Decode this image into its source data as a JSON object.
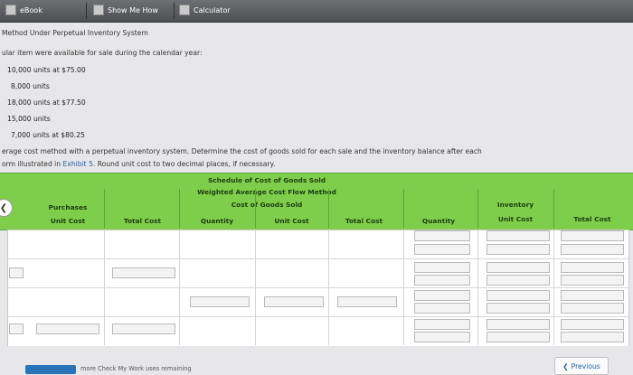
{
  "toolbar": {
    "ebook": "eBook",
    "show_me_how": "Show Me How",
    "calculator": "Calculator"
  },
  "content": {
    "heading": "Method Under Perpetual Inventory System",
    "intro": "ular item were available for sale during the calendar year:",
    "units": [
      "10,000 units at $75.00",
      "8,000 units",
      "18,000 units at $77.50",
      "15,000 units",
      "7,000 units at $80.25"
    ],
    "instruction_line1": "erage cost method with a perpetual inventory system. Determine the cost of goods sold for each sale and the inventory balance after each",
    "instruction_line2_pre": "orm illustrated in ",
    "instruction_link": "Exhibit 5",
    "instruction_line2_post": ". Round unit cost to two decimal places, if necessary."
  },
  "schedule": {
    "title1": "Schedule of Cost of Goods Sold",
    "title2": "Weighted Average Cost Flow Method",
    "cogs_group": "Cost of Goods Sold",
    "purchases_group": "Purchases",
    "inventory_group": "Inventory",
    "col_unit_cost_1": "Unit Cost",
    "col_total_cost_1": "Total Cost",
    "col_quantity_2": "Quantity",
    "col_unit_cost_2": "Unit Cost",
    "col_total_cost_2": "Total Cost",
    "col_quantity_3": "Quantity",
    "col_unit_cost_3": "Unit Cost",
    "col_total_cost_3": "Total Cost"
  },
  "footer": {
    "remaining": "more Check My Work uses remaining",
    "previous": "Previous"
  }
}
